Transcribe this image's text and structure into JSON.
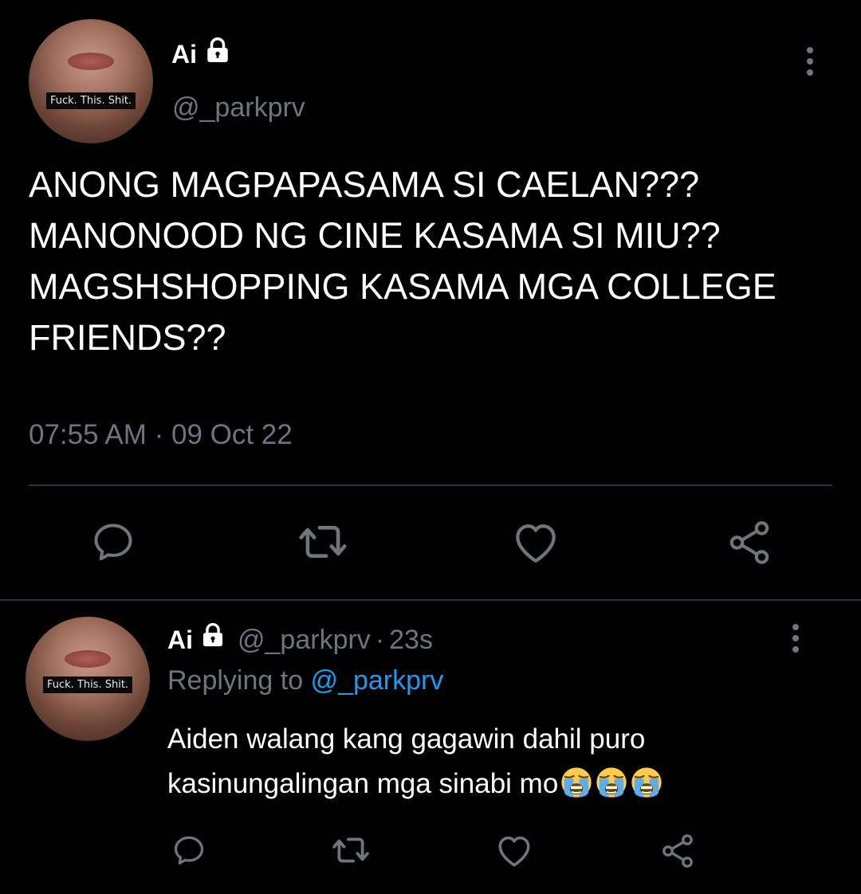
{
  "tweet": {
    "author_name": "Ai",
    "author_handle": "@_parkprv",
    "avatar_caption": "Fuck. This. Shit.",
    "text": "ANONG MAGPAPASAMA SI CAELAN??? MANONOOD NG CINE KASAMA SI MIU?? MAGSHSHOPPING KASAMA MGA COLLEGE FRIENDS??",
    "timestamp": "07:55 AM · 09 Oct 22"
  },
  "reply": {
    "author_name": "Ai",
    "author_handle": "@_parkprv",
    "separator": "·",
    "time_ago": "23s",
    "replying_prefix": "Replying to ",
    "replying_to": "@_parkprv",
    "avatar_caption": "Fuck. This. Shit.",
    "text": "Aiden walang kang gagawin dahil puro kasinungalingan mga sinabi mo",
    "emoji_count": 3,
    "emoji_name": "loudly-crying-face"
  },
  "icons": {
    "reply": "comment-icon",
    "retweet": "retweet-icon",
    "like": "heart-icon",
    "share": "share-icon",
    "more": "more-vertical-icon",
    "lock": "lock-icon"
  },
  "colors": {
    "background": "#000000",
    "text": "#ffffff",
    "secondary": "#6e767d",
    "link": "#1d9bf0",
    "divider": "#2f3336"
  }
}
